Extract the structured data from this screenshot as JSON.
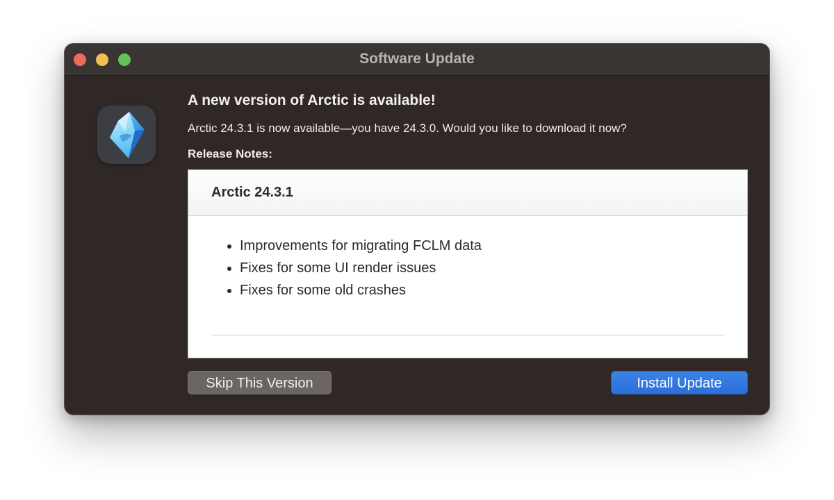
{
  "window": {
    "title": "Software Update",
    "traffic_lights": [
      "close",
      "minimize",
      "maximize"
    ]
  },
  "app": {
    "icon": "arctic-crystal-icon",
    "headline": "A new version of Arctic is available!",
    "subtitle": "Arctic 24.3.1 is now available—you have 24.3.0. Would you like to download it now?"
  },
  "release_notes": {
    "label": "Release Notes:",
    "title": "Arctic 24.3.1",
    "items": [
      "Improvements for migrating FCLM data",
      "Fixes for some UI render issues",
      "Fixes for some old crashes"
    ]
  },
  "buttons": {
    "skip": "Skip This Version",
    "install": "Install Update"
  },
  "colors": {
    "window_bg": "#2f2826",
    "titlebar_bg": "#3a3432",
    "close": "#ed6a5e",
    "minimize": "#f5bf4f",
    "maximize": "#61c554",
    "accent": "#2b6fd8"
  }
}
